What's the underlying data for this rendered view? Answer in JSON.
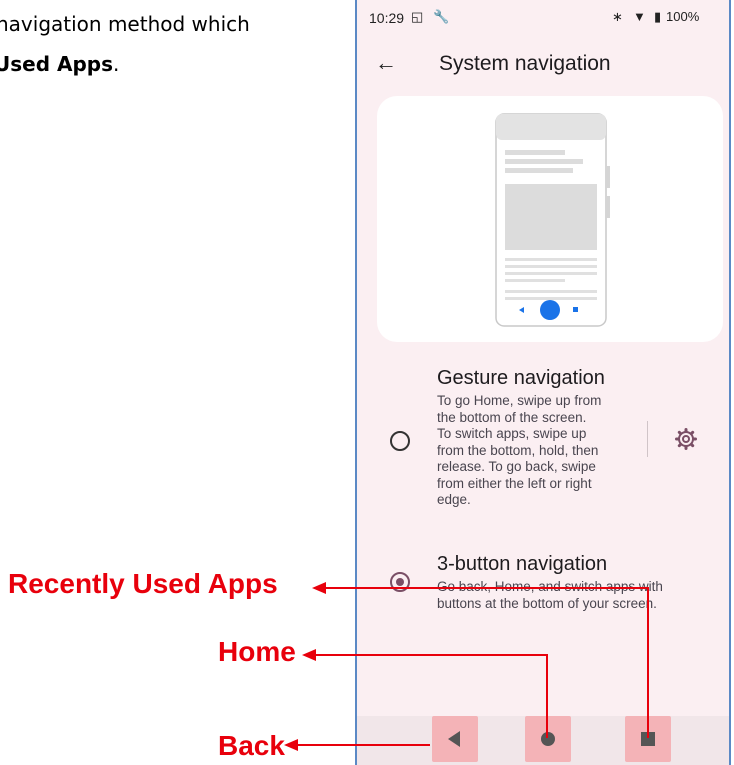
{
  "document": {
    "line1": "navigation method which",
    "line2_prefix": "",
    "line2_bold": "Used Apps",
    "line2_suffix": "."
  },
  "phone": {
    "status_bar": {
      "time": "10:29",
      "battery": "100%"
    },
    "app_bar": {
      "title": "System navigation"
    },
    "options": [
      {
        "title": "Gesture navigation",
        "description_lines": [
          "To go Home, swipe up from",
          "the bottom of the screen.",
          "To switch apps, swipe up",
          "from the bottom, hold, then",
          "release. To go back, swipe",
          "from either the left or right",
          "edge."
        ],
        "selected": false
      },
      {
        "title": "3-button navigation",
        "description_lines": [
          "Go back, Home, and switch apps with",
          "buttons at the bottom of your screen."
        ],
        "selected": true
      }
    ]
  },
  "annotations": {
    "recent_label": "Recently Used Apps",
    "home_label": "Home",
    "back_label": "Back"
  },
  "colors": {
    "annotation": "#e8000c",
    "accent": "#7a4f66",
    "phone_bg": "#fbeff2",
    "frame": "#5b89c5"
  }
}
